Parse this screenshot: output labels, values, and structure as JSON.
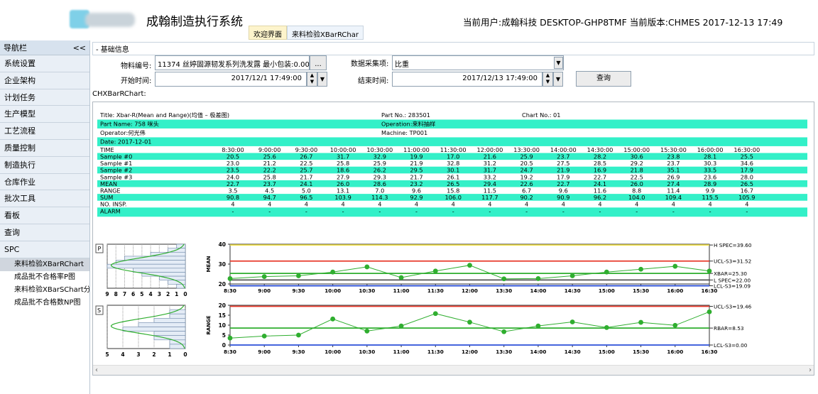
{
  "app": {
    "title": "成翰制造执行系统"
  },
  "tabs": [
    "欢迎界面",
    "来料检验XBarRChar"
  ],
  "status": "当前用户:成翰科技 DESKTOP-GHP8TMF  当前版本:CHMES  2017-12-13 17:49",
  "nav": {
    "header": "导航栏",
    "collapse": "<<",
    "items": [
      "系统设置",
      "企业架构",
      "计划任务",
      "生产模型",
      "工艺流程",
      "质量控制",
      "制造执行",
      "仓库作业",
      "批次工具",
      "看板",
      "查询",
      "SPC"
    ],
    "spc_sub": [
      "来料检验XBarRChart",
      "成品批不合格率P图",
      "来料检验XBarSChart分",
      "成品批不合格数NP图"
    ]
  },
  "form": {
    "group_title": "- 基础信息",
    "material_label": "物料编号:",
    "material_value": "11374 丝婷固源韧发系列洗发露 最小包装:0.00",
    "ellipsis": "...",
    "datatype_label": "数据采集项:",
    "datatype_value": "比重",
    "start_label": "开始时间:",
    "start_value": "2017/12/1 17:49:00",
    "end_label": "结束时间:",
    "end_value": "2017/12/13 17:49:00",
    "query_button": "查询"
  },
  "chart_caption": "CHXBarRChart:",
  "chart_data": {
    "type": "table",
    "title": "Title: Xbar-R(Mean and Range)(均值 – 极差图)",
    "part_no": "Part No.: 283501",
    "chart_no": "Chart No.: 01",
    "part_name": "Part Name: 758 咪头",
    "operation": "Operation:来料抽样",
    "operator": "Operator:何光伟",
    "machine": "Machine: TP001",
    "date": "Date: 2017-12-01",
    "times": [
      "8:30:00",
      "9:00:00",
      "9:30:00",
      "10:00:00",
      "10:30:00",
      "11:00:00",
      "11:30:00",
      "12:00:00",
      "13:30:00",
      "14:00:00",
      "14:30:00",
      "15:00:00",
      "15:30:00",
      "16:00:00",
      "16:30:00"
    ],
    "row_labels": [
      "TIME",
      "Sample #0",
      "Sample #1",
      "Sample #2",
      "Sample #3",
      "MEAN",
      "RANGE",
      "SUM",
      "NO. INSP.",
      "ALARM"
    ],
    "samples": [
      [
        20.5,
        25.6,
        26.7,
        31.7,
        32.9,
        19.9,
        17.0,
        21.6,
        25.9,
        23.7,
        28.2,
        30.6,
        23.8,
        28.1,
        25.5
      ],
      [
        23.0,
        21.2,
        22.5,
        25.8,
        25.9,
        21.9,
        32.8,
        31.2,
        20.5,
        27.5,
        28.5,
        29.2,
        23.7,
        30.3,
        34.6
      ],
      [
        23.5,
        22.2,
        25.7,
        18.6,
        26.2,
        29.5,
        30.1,
        31.7,
        24.7,
        21.9,
        16.9,
        21.8,
        35.1,
        33.5,
        17.9
      ],
      [
        24.0,
        25.8,
        21.7,
        27.9,
        29.3,
        21.7,
        26.1,
        33.2,
        19.2,
        17.9,
        22.7,
        22.5,
        26.9,
        23.6,
        28.0
      ]
    ],
    "mean": [
      22.7,
      23.7,
      24.1,
      26.0,
      28.6,
      23.2,
      26.5,
      29.4,
      22.6,
      22.7,
      24.1,
      26.0,
      27.4,
      28.9,
      26.5
    ],
    "range": [
      3.5,
      4.5,
      5.0,
      13.1,
      7.0,
      9.6,
      15.8,
      11.5,
      6.7,
      9.6,
      11.6,
      8.8,
      11.4,
      9.9,
      16.7
    ],
    "sum": [
      90.8,
      94.7,
      96.5,
      103.9,
      114.3,
      92.9,
      106.0,
      117.7,
      90.2,
      90.9,
      96.2,
      104.0,
      109.4,
      115.5,
      105.9
    ],
    "no_insp": [
      4,
      4,
      4,
      4,
      4,
      4,
      4,
      4,
      4,
      4,
      4,
      4,
      4,
      4,
      4
    ],
    "alarm": "-",
    "x_ticks": [
      "8:30",
      "9:00",
      "9:30",
      "10:00",
      "10:30",
      "11:00",
      "11:30",
      "12:00",
      "13:30",
      "14:00",
      "14:30",
      "15:00",
      "15:30",
      "16:00",
      "16:30"
    ],
    "mean_chart": {
      "box_label": "P",
      "ylabel": "MEAN",
      "ylim": [
        20,
        40
      ],
      "yticks": [
        20,
        30,
        40
      ],
      "lines": {
        "hspec": 39.6,
        "ucl": 31.52,
        "xbar": 25.3,
        "lspec": 22.0,
        "lcl": 19.09
      },
      "line_labels": [
        "H SPEC=39.60",
        "UCL-S3=31.52",
        "XBAR=25.30",
        "L SPEC=22.00",
        "LCL-S3=19.09"
      ],
      "hist_ticks": [
        "9",
        "8",
        "7",
        "6",
        "5",
        "4",
        "3",
        "2",
        "1",
        "0"
      ],
      "hist_counts": [
        1,
        2,
        4,
        7,
        8,
        9,
        6,
        5,
        3,
        2,
        1
      ]
    },
    "range_chart": {
      "box_label": "S",
      "ylabel": "RANGE",
      "ylim": [
        0,
        20
      ],
      "yticks": [
        0,
        5,
        10,
        15,
        20
      ],
      "lines": {
        "ucl": 19.46,
        "rbar": 8.53,
        "lcl": 0.0
      },
      "line_labels": [
        "UCL-S3=19.46",
        "RBAR=8.53",
        "LCL-S3=0.00"
      ],
      "hist_ticks": [
        "5",
        "4",
        "3",
        "2",
        "1",
        "0"
      ],
      "hist_counts": [
        0,
        1,
        1,
        2,
        3,
        4,
        2,
        2,
        1,
        1
      ]
    }
  },
  "colors": {
    "row_highlight": "#33f0c8",
    "accent_red": "#e8392a",
    "accent_green": "#2fae2f",
    "accent_blue": "#2b4fd8",
    "accent_yellow": "#f2e14a"
  }
}
